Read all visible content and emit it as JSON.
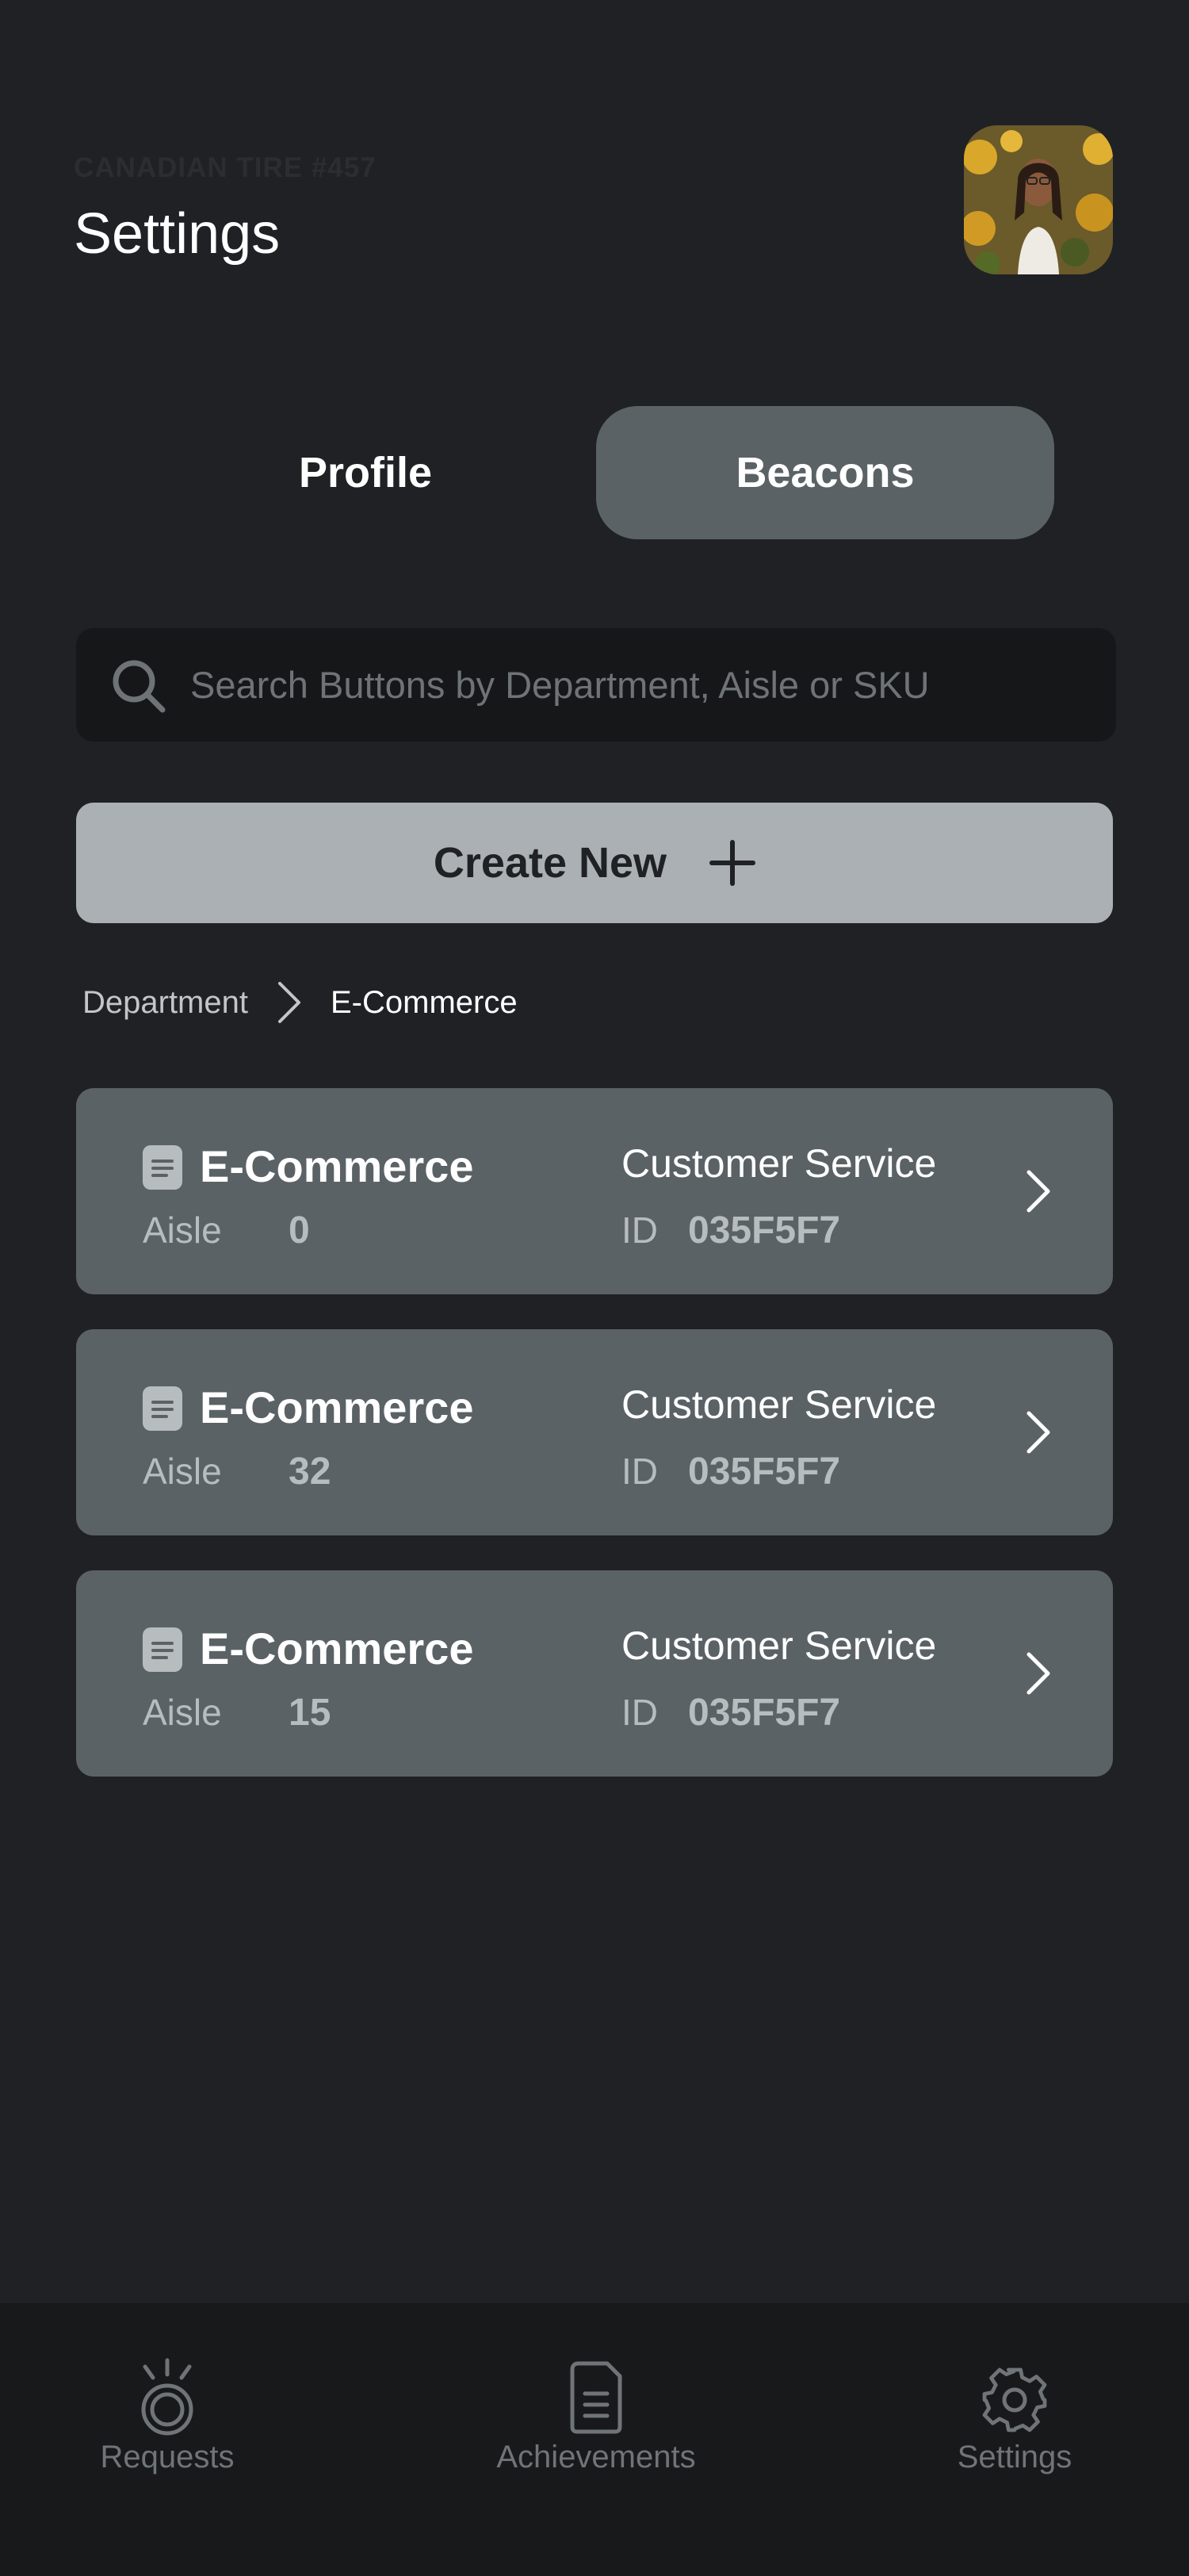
{
  "header": {
    "store_name": "CANADIAN TIRE #457",
    "title": "Settings"
  },
  "tabs": [
    {
      "label": "Profile",
      "active": false
    },
    {
      "label": "Beacons",
      "active": true
    }
  ],
  "search": {
    "placeholder": "Search Buttons by Department, Aisle or SKU",
    "icon": "search-icon"
  },
  "create_button": {
    "label": "Create New",
    "icon": "plus-icon"
  },
  "breadcrumb": {
    "root": "Department",
    "current": "E-Commerce"
  },
  "beacons": [
    {
      "department": "E-Commerce",
      "aisle_label": "Aisle",
      "aisle": "0",
      "service": "Customer Service",
      "id_label": "ID",
      "id": "035F5F7"
    },
    {
      "department": "E-Commerce",
      "aisle_label": "Aisle",
      "aisle": "32",
      "service": "Customer Service",
      "id_label": "ID",
      "id": "035F5F7"
    },
    {
      "department": "E-Commerce",
      "aisle_label": "Aisle",
      "aisle": "15",
      "service": "Customer Service",
      "id_label": "ID",
      "id": "035F5F7"
    }
  ],
  "bottom_nav": [
    {
      "label": "Requests",
      "icon": "beacon-icon"
    },
    {
      "label": "Achievements",
      "icon": "document-icon"
    },
    {
      "label": "Settings",
      "icon": "gear-icon"
    }
  ],
  "colors": {
    "background": "#202125",
    "tab_active": "#5b6266",
    "card": "#5b6266",
    "create_button": "#aab0b3",
    "search_bg": "#161719",
    "nav_bg": "#18191b"
  }
}
